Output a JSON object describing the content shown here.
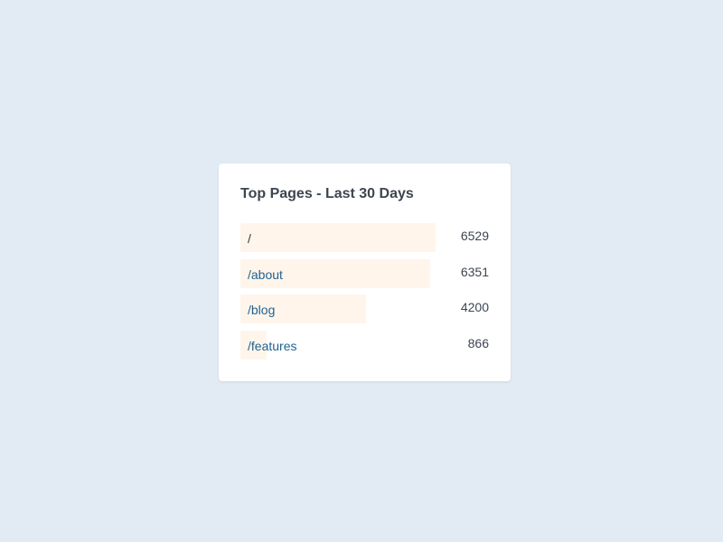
{
  "chart_data": {
    "type": "bar",
    "title": "Top Pages - Last 30 Days",
    "categories": [
      "/",
      "/about",
      "/blog",
      "/features"
    ],
    "values": [
      6529,
      6351,
      4200,
      866
    ],
    "xlim": [
      0,
      6529
    ],
    "orientation": "horizontal",
    "colors": {
      "bar": "#fff5eb",
      "link_text": "#1f6391",
      "plain_text": "#2f3742",
      "value_text": "#3e4550"
    }
  },
  "rows": [
    {
      "label": "/",
      "value": "6529",
      "link": false
    },
    {
      "label": "/about",
      "value": "6351",
      "link": true
    },
    {
      "label": "/blog",
      "value": "4200",
      "link": true
    },
    {
      "label": "/features",
      "value": "866",
      "link": true
    }
  ]
}
